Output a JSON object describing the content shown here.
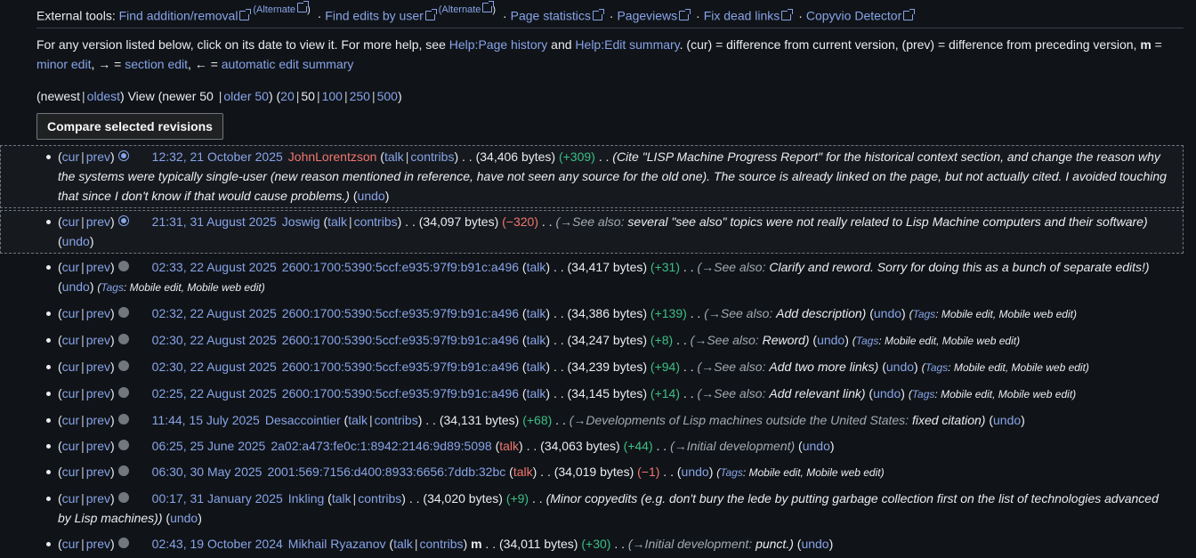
{
  "external_tools": {
    "label": "External tools:",
    "find_addition": "Find addition/removal",
    "alternate": "(Alternate",
    "find_edits": "Find edits by user",
    "page_stats": "Page statistics",
    "pageviews": "Pageviews",
    "fix_dead": "Fix dead links",
    "copyvio": "Copyvio Detector"
  },
  "help": {
    "intro": "For any version listed below, click on its date to view it. For more help, see ",
    "page_history": "Help:Page history",
    "and": " and ",
    "edit_summary": "Help:Edit summary",
    "legend1": ". (cur) = difference from current version, (prev) = difference from preceding version, ",
    "m": "m",
    "eq": " = ",
    "minor_edit": "minor edit",
    "arrow1": ", → = ",
    "section_edit": "section edit",
    "arrow2": ", ← = ",
    "auto_summary": "automatic edit summary"
  },
  "nav": {
    "newest": "newest",
    "oldest": "oldest",
    "view": ") View (newer 50 ",
    "older": "older 50",
    "counts": [
      "20",
      "50",
      "100",
      "250",
      "500"
    ]
  },
  "compare_label": "Compare selected revisions",
  "revisions": [
    {
      "date": "12:32, 21 October 2025",
      "user": "JohnLorentzson",
      "user_red": true,
      "contribs": true,
      "bytes": "(34,406 bytes)",
      "diff": "(+309)",
      "diff_type": "pos",
      "minor": false,
      "section": "",
      "comment": "(Cite \"LISP Machine Progress Report\" for the historical context section, and change the reason why the systems were typically single-user (new reason mentioned in reference, have not seen any source for the old one). The source is already linked on the page, but not actually cited. I avoided touching that since I don't know if that would cause problems.)",
      "undo": "undo",
      "tags": "",
      "radio_on": true,
      "selected": true
    },
    {
      "date": "21:31, 31 August 2025",
      "user": "Joswig",
      "user_red": false,
      "contribs": true,
      "bytes": "(34,097 bytes)",
      "diff": "(−320)",
      "diff_type": "neg",
      "minor": false,
      "section": "(→See also:",
      "comment": "several \"see also\" topics were not really related to Lisp Machine computers and their software)",
      "undo": "undo",
      "tags": "",
      "radio_on": true,
      "selected": true
    },
    {
      "date": "02:33, 22 August 2025",
      "user": "2600:1700:5390:5ccf:e935:97f9:b91c:a496",
      "user_red": false,
      "contribs": false,
      "bytes": "(34,417 bytes)",
      "diff": "(+31)",
      "diff_type": "pos",
      "minor": false,
      "section": "(→See also:",
      "comment": "Clarify and reword. Sorry for doing this as a bunch of separate edits!)",
      "undo": "undo",
      "tags": "Mobile edit, Mobile web edit",
      "radio_on": false,
      "selected": false
    },
    {
      "date": "02:32, 22 August 2025",
      "user": "2600:1700:5390:5ccf:e935:97f9:b91c:a496",
      "user_red": false,
      "contribs": false,
      "bytes": "(34,386 bytes)",
      "diff": "(+139)",
      "diff_type": "pos",
      "minor": false,
      "section": "(→See also:",
      "comment": "Add description)",
      "undo": "undo",
      "tags": "Mobile edit, Mobile web edit",
      "radio_on": false,
      "selected": false
    },
    {
      "date": "02:30, 22 August 2025",
      "user": "2600:1700:5390:5ccf:e935:97f9:b91c:a496",
      "user_red": false,
      "contribs": false,
      "bytes": "(34,247 bytes)",
      "diff": "(+8)",
      "diff_type": "pos",
      "minor": false,
      "section": "(→See also:",
      "comment": "Reword)",
      "undo": "undo",
      "tags": "Mobile edit, Mobile web edit",
      "radio_on": false,
      "selected": false
    },
    {
      "date": "02:30, 22 August 2025",
      "user": "2600:1700:5390:5ccf:e935:97f9:b91c:a496",
      "user_red": false,
      "contribs": false,
      "bytes": "(34,239 bytes)",
      "diff": "(+94)",
      "diff_type": "pos",
      "minor": false,
      "section": "(→See also:",
      "comment": "Add two more links)",
      "undo": "undo",
      "tags": "Mobile edit, Mobile web edit",
      "radio_on": false,
      "selected": false
    },
    {
      "date": "02:25, 22 August 2025",
      "user": "2600:1700:5390:5ccf:e935:97f9:b91c:a496",
      "user_red": false,
      "contribs": false,
      "bytes": "(34,145 bytes)",
      "diff": "(+14)",
      "diff_type": "pos",
      "minor": false,
      "section": "(→See also:",
      "comment": "Add relevant link)",
      "undo": "undo",
      "tags": "Mobile edit, Mobile web edit",
      "radio_on": false,
      "selected": false
    },
    {
      "date": "11:44, 15 July 2025",
      "user": "Desaccointier",
      "user_red": false,
      "contribs": true,
      "bytes": "(34,131 bytes)",
      "diff": "(+68)",
      "diff_type": "pos",
      "minor": false,
      "section": "(→Developments of Lisp machines outside the United States:",
      "comment": "fixed citation)",
      "undo": "undo",
      "tags": "",
      "radio_on": false,
      "selected": false
    },
    {
      "date": "06:25, 25 June 2025",
      "user": "2a02:a473:fe0c:1:8942:2146:9d89:5098",
      "user_red": false,
      "contribs": false,
      "talk_red": true,
      "bytes": "(34,063 bytes)",
      "diff": "(+44)",
      "diff_type": "pos",
      "minor": false,
      "section": "(→Initial development)",
      "comment": "",
      "undo": "undo",
      "tags": "",
      "radio_on": false,
      "selected": false
    },
    {
      "date": "06:30, 30 May 2025",
      "user": "2001:569:7156:d400:8933:6656:7ddb:32bc",
      "user_red": false,
      "contribs": false,
      "talk_red": true,
      "bytes": "(34,019 bytes)",
      "diff": "(−1)",
      "diff_type": "neg",
      "minor": false,
      "section": "",
      "comment": "",
      "undo": "undo",
      "tags": "Mobile edit, Mobile web edit",
      "radio_on": false,
      "selected": false
    },
    {
      "date": "00:17, 31 January 2025",
      "user": "Inkling",
      "user_red": false,
      "contribs": true,
      "bytes": "(34,020 bytes)",
      "diff": "(+9)",
      "diff_type": "pos",
      "minor": false,
      "section": "",
      "comment": "(Minor copyedits (e.g. don't bury the lede by putting garbage collection first on the list of technologies advanced by Lisp machines))",
      "undo": "undo",
      "tags": "",
      "radio_on": false,
      "selected": false
    },
    {
      "date": "02:43, 19 October 2024",
      "user": "Mikhail Ryazanov",
      "user_red": false,
      "contribs": true,
      "bytes": "(34,011 bytes)",
      "diff": "(+30)",
      "diff_type": "pos",
      "minor": true,
      "section": "(→Initial development:",
      "comment": "punct.)",
      "undo": "undo",
      "tags": "",
      "radio_on": false,
      "selected": false
    }
  ],
  "row_labels": {
    "cur": "cur",
    "prev": "prev",
    "talk": "talk",
    "contribs": "contribs",
    "minor_mark": "m",
    "dots": "‎ . . ",
    "tags_label": "Tags"
  }
}
